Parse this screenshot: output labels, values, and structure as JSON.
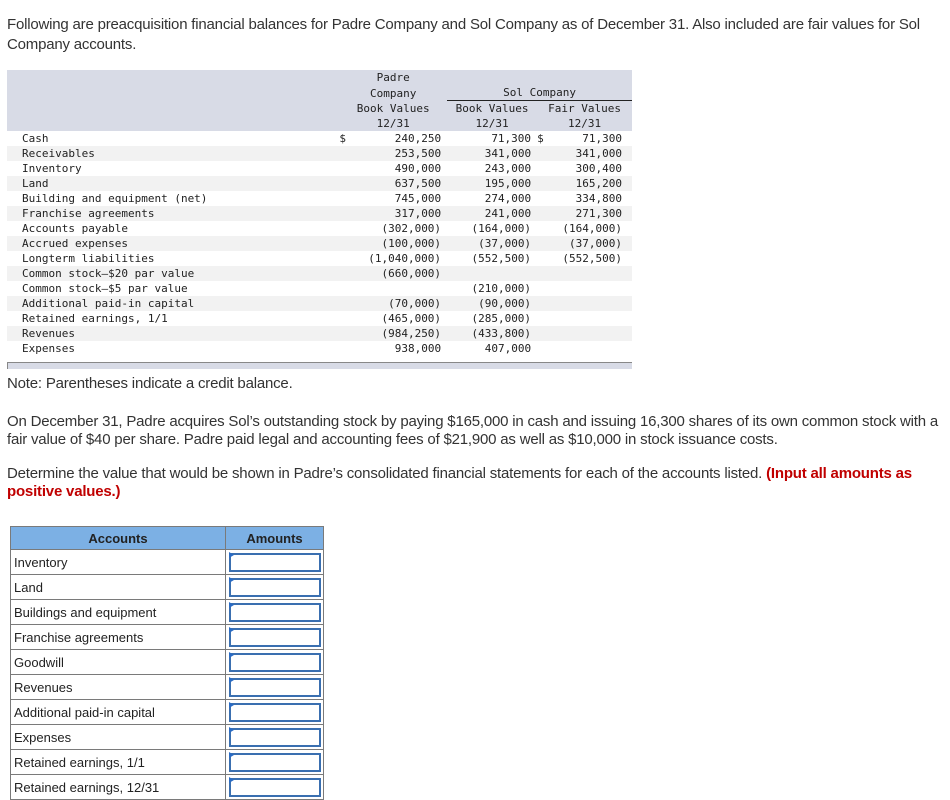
{
  "intro": "Following are preacquisition financial balances for Padre Company and Sol Company as of December 31. Also included are fair values for Sol Company accounts.",
  "table": {
    "headers": {
      "padre_line1": "Padre",
      "padre_line2": "Company",
      "padre_line3": "Book Values",
      "padre_line4": "12/31",
      "sol_group": "Sol Company",
      "sol_bv_line1": "Book Values",
      "sol_bv_line2": "12/31",
      "sol_fv_line1": "Fair Values",
      "sol_fv_line2": "12/31"
    },
    "currency_symbol": "$",
    "rows": [
      {
        "label": "Cash",
        "padre": "240,250",
        "sol_bv": "71,300",
        "sol_fv": "71,300",
        "padre_dollar": "$",
        "fv_dollar": "$"
      },
      {
        "label": "Receivables",
        "padre": "253,500",
        "sol_bv": "341,000",
        "sol_fv": "341,000"
      },
      {
        "label": "Inventory",
        "padre": "490,000",
        "sol_bv": "243,000",
        "sol_fv": "300,400"
      },
      {
        "label": "Land",
        "padre": "637,500",
        "sol_bv": "195,000",
        "sol_fv": "165,200"
      },
      {
        "label": "Building and equipment (net)",
        "padre": "745,000",
        "sol_bv": "274,000",
        "sol_fv": "334,800"
      },
      {
        "label": "Franchise agreements",
        "padre": "317,000",
        "sol_bv": "241,000",
        "sol_fv": "271,300"
      },
      {
        "label": "Accounts payable",
        "padre": "(302,000)",
        "sol_bv": "(164,000)",
        "sol_fv": "(164,000)"
      },
      {
        "label": "Accrued expenses",
        "padre": "(100,000)",
        "sol_bv": "(37,000)",
        "sol_fv": "(37,000)"
      },
      {
        "label": "Longterm liabilities",
        "padre": "(1,040,000)",
        "sol_bv": "(552,500)",
        "sol_fv": "(552,500)"
      },
      {
        "label": "Common stock—$20 par value",
        "padre": "(660,000)",
        "sol_bv": "",
        "sol_fv": ""
      },
      {
        "label": "Common stock—$5 par value",
        "padre": "",
        "sol_bv": "(210,000)",
        "sol_fv": ""
      },
      {
        "label": "Additional paid-in capital",
        "padre": "(70,000)",
        "sol_bv": "(90,000)",
        "sol_fv": ""
      },
      {
        "label": "Retained earnings, 1/1",
        "padre": "(465,000)",
        "sol_bv": "(285,000)",
        "sol_fv": ""
      },
      {
        "label": "Revenues",
        "padre": "(984,250)",
        "sol_bv": "(433,800)",
        "sol_fv": ""
      },
      {
        "label": "Expenses",
        "padre": "938,000",
        "sol_bv": "407,000",
        "sol_fv": ""
      }
    ]
  },
  "note": "Note: Parentheses indicate a credit balance.",
  "paragraph2": "On December 31, Padre acquires Sol’s outstanding stock by paying $165,000 in cash and issuing 16,300 shares of its own common stock with a fair value of $40 per share. Padre paid legal and accounting fees of $21,900 as well as $10,000 in stock issuance costs.",
  "paragraph3_text": "Determine the value that would be shown in Padre’s consolidated financial statements for each of the accounts listed. ",
  "paragraph3_emphasis": "(Input all amounts as positive values.)",
  "answer_table": {
    "header_accounts": "Accounts",
    "header_amounts": "Amounts",
    "rows": [
      {
        "account": "Inventory",
        "value": ""
      },
      {
        "account": "Land",
        "value": ""
      },
      {
        "account": "Buildings and equipment",
        "value": ""
      },
      {
        "account": "Franchise agreements",
        "value": ""
      },
      {
        "account": "Goodwill",
        "value": ""
      },
      {
        "account": "Revenues",
        "value": ""
      },
      {
        "account": "Additional paid-in capital",
        "value": ""
      },
      {
        "account": "Expenses",
        "value": ""
      },
      {
        "account": "Retained earnings, 1/1",
        "value": ""
      },
      {
        "account": "Retained earnings, 12/31",
        "value": ""
      }
    ]
  },
  "colors": {
    "table_header_bg": "#d8dbe6",
    "answer_header_bg": "#7cb0e4",
    "input_border": "#3a6fb0",
    "emphasis_red": "#c00000"
  }
}
